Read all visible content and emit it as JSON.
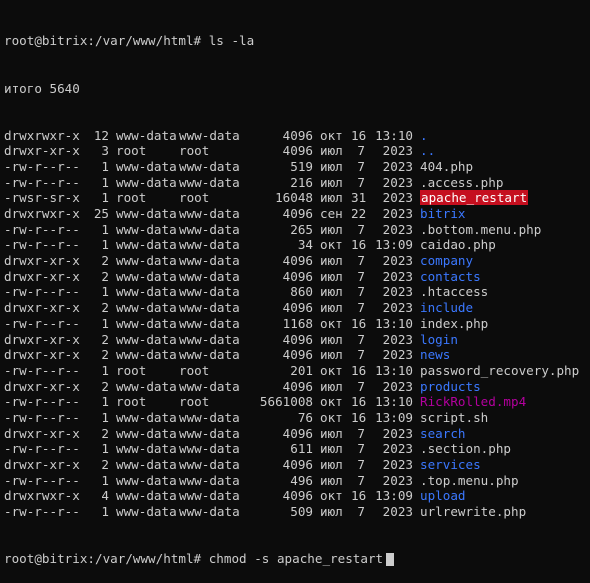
{
  "colors": {
    "background": "#0c0c0c",
    "foreground": "#cccccc",
    "directory": "#3b78ff",
    "setuid_bg": "#c50f1f",
    "setuid_fg": "#ffffff",
    "media": "#b4009e"
  },
  "prompt_1": "root@bitrix:/var/www/html# ls -la",
  "total_line": "итого 5640",
  "entries": [
    {
      "perm": "drwxrwxr-x",
      "links": "12",
      "owner": "www-data",
      "group": "www-data",
      "size": "4096",
      "month": "окт",
      "day": "16",
      "time": "13:10",
      "name": ".",
      "kind": "dir"
    },
    {
      "perm": "drwxr-xr-x",
      "links": "3",
      "owner": "root",
      "group": "root",
      "size": "4096",
      "month": "июл",
      "day": "7",
      "time": "2023",
      "name": "..",
      "kind": "dir"
    },
    {
      "perm": "-rw-r--r--",
      "links": "1",
      "owner": "www-data",
      "group": "www-data",
      "size": "519",
      "month": "июл",
      "day": "7",
      "time": "2023",
      "name": "404.php",
      "kind": "file"
    },
    {
      "perm": "-rw-r--r--",
      "links": "1",
      "owner": "www-data",
      "group": "www-data",
      "size": "216",
      "month": "июл",
      "day": "7",
      "time": "2023",
      "name": ".access.php",
      "kind": "file"
    },
    {
      "perm": "-rwsr-sr-x",
      "links": "1",
      "owner": "root",
      "group": "root",
      "size": "16048",
      "month": "июл",
      "day": "31",
      "time": "2023",
      "name": "apache_restart",
      "kind": "suid"
    },
    {
      "perm": "drwxrwxr-x",
      "links": "25",
      "owner": "www-data",
      "group": "www-data",
      "size": "4096",
      "month": "сен",
      "day": "22",
      "time": "2023",
      "name": "bitrix",
      "kind": "dir"
    },
    {
      "perm": "-rw-r--r--",
      "links": "1",
      "owner": "www-data",
      "group": "www-data",
      "size": "265",
      "month": "июл",
      "day": "7",
      "time": "2023",
      "name": ".bottom.menu.php",
      "kind": "file"
    },
    {
      "perm": "-rw-r--r--",
      "links": "1",
      "owner": "www-data",
      "group": "www-data",
      "size": "34",
      "month": "окт",
      "day": "16",
      "time": "13:09",
      "name": "caidao.php",
      "kind": "file"
    },
    {
      "perm": "drwxr-xr-x",
      "links": "2",
      "owner": "www-data",
      "group": "www-data",
      "size": "4096",
      "month": "июл",
      "day": "7",
      "time": "2023",
      "name": "company",
      "kind": "dir"
    },
    {
      "perm": "drwxr-xr-x",
      "links": "2",
      "owner": "www-data",
      "group": "www-data",
      "size": "4096",
      "month": "июл",
      "day": "7",
      "time": "2023",
      "name": "contacts",
      "kind": "dir"
    },
    {
      "perm": "-rw-r--r--",
      "links": "1",
      "owner": "www-data",
      "group": "www-data",
      "size": "860",
      "month": "июл",
      "day": "7",
      "time": "2023",
      "name": ".htaccess",
      "kind": "file"
    },
    {
      "perm": "drwxr-xr-x",
      "links": "2",
      "owner": "www-data",
      "group": "www-data",
      "size": "4096",
      "month": "июл",
      "day": "7",
      "time": "2023",
      "name": "include",
      "kind": "dir"
    },
    {
      "perm": "-rw-r--r--",
      "links": "1",
      "owner": "www-data",
      "group": "www-data",
      "size": "1168",
      "month": "окт",
      "day": "16",
      "time": "13:10",
      "name": "index.php",
      "kind": "file"
    },
    {
      "perm": "drwxr-xr-x",
      "links": "2",
      "owner": "www-data",
      "group": "www-data",
      "size": "4096",
      "month": "июл",
      "day": "7",
      "time": "2023",
      "name": "login",
      "kind": "dir"
    },
    {
      "perm": "drwxr-xr-x",
      "links": "2",
      "owner": "www-data",
      "group": "www-data",
      "size": "4096",
      "month": "июл",
      "day": "7",
      "time": "2023",
      "name": "news",
      "kind": "dir"
    },
    {
      "perm": "-rw-r--r--",
      "links": "1",
      "owner": "root",
      "group": "root",
      "size": "201",
      "month": "окт",
      "day": "16",
      "time": "13:10",
      "name": "password_recovery.php",
      "kind": "file"
    },
    {
      "perm": "drwxr-xr-x",
      "links": "2",
      "owner": "www-data",
      "group": "www-data",
      "size": "4096",
      "month": "июл",
      "day": "7",
      "time": "2023",
      "name": "products",
      "kind": "dir"
    },
    {
      "perm": "-rw-r--r--",
      "links": "1",
      "owner": "root",
      "group": "root",
      "size": "5661008",
      "month": "окт",
      "day": "16",
      "time": "13:10",
      "name": "RickRolled.mp4",
      "kind": "media"
    },
    {
      "perm": "-rw-r--r--",
      "links": "1",
      "owner": "www-data",
      "group": "www-data",
      "size": "76",
      "month": "окт",
      "day": "16",
      "time": "13:09",
      "name": "script.sh",
      "kind": "file"
    },
    {
      "perm": "drwxr-xr-x",
      "links": "2",
      "owner": "www-data",
      "group": "www-data",
      "size": "4096",
      "month": "июл",
      "day": "7",
      "time": "2023",
      "name": "search",
      "kind": "dir"
    },
    {
      "perm": "-rw-r--r--",
      "links": "1",
      "owner": "www-data",
      "group": "www-data",
      "size": "611",
      "month": "июл",
      "day": "7",
      "time": "2023",
      "name": ".section.php",
      "kind": "file"
    },
    {
      "perm": "drwxr-xr-x",
      "links": "2",
      "owner": "www-data",
      "group": "www-data",
      "size": "4096",
      "month": "июл",
      "day": "7",
      "time": "2023",
      "name": "services",
      "kind": "dir"
    },
    {
      "perm": "-rw-r--r--",
      "links": "1",
      "owner": "www-data",
      "group": "www-data",
      "size": "496",
      "month": "июл",
      "day": "7",
      "time": "2023",
      "name": ".top.menu.php",
      "kind": "file"
    },
    {
      "perm": "drwxrwxr-x",
      "links": "4",
      "owner": "www-data",
      "group": "www-data",
      "size": "4096",
      "month": "окт",
      "day": "16",
      "time": "13:09",
      "name": "upload",
      "kind": "dir"
    },
    {
      "perm": "-rw-r--r--",
      "links": "1",
      "owner": "www-data",
      "group": "www-data",
      "size": "509",
      "month": "июл",
      "day": "7",
      "time": "2023",
      "name": "urlrewrite.php",
      "kind": "file"
    }
  ],
  "prompt_2": "root@bitrix:/var/www/html# chmod -s apache_restart"
}
